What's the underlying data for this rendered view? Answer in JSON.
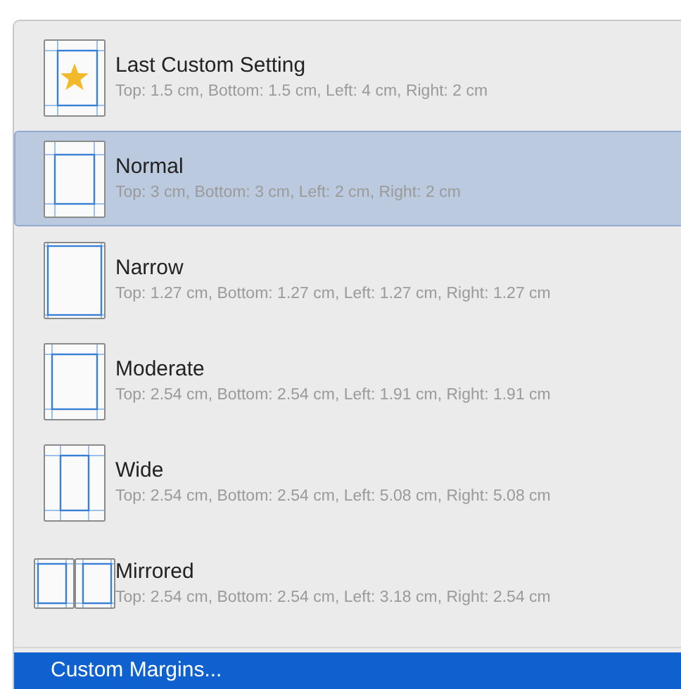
{
  "margin_presets": [
    {
      "kind": "custom",
      "name": "Last Custom Setting",
      "detail": "Top: 1.5 cm, Bottom: 1.5 cm, Left: 4 cm, Right: 2 cm",
      "selected": false
    },
    {
      "kind": "normal",
      "name": "Normal",
      "detail": "Top: 3 cm, Bottom: 3 cm, Left: 2 cm, Right: 2 cm",
      "selected": true
    },
    {
      "kind": "narrow",
      "name": "Narrow",
      "detail": "Top: 1.27 cm, Bottom: 1.27 cm, Left: 1.27 cm, Right: 1.27 cm",
      "selected": false
    },
    {
      "kind": "moderate",
      "name": "Moderate",
      "detail": "Top: 2.54 cm, Bottom: 2.54 cm, Left: 1.91 cm, Right: 1.91 cm",
      "selected": false
    },
    {
      "kind": "wide",
      "name": "Wide",
      "detail": "Top: 2.54 cm, Bottom: 2.54 cm, Left: 5.08 cm, Right: 5.08 cm",
      "selected": false
    },
    {
      "kind": "mirrored",
      "name": "Mirrored",
      "detail": "Top: 2.54 cm, Bottom: 2.54 cm, Left: 3.18 cm, Right: 2.54 cm",
      "selected": false
    }
  ],
  "custom_margins_item": "Custom Margins..."
}
